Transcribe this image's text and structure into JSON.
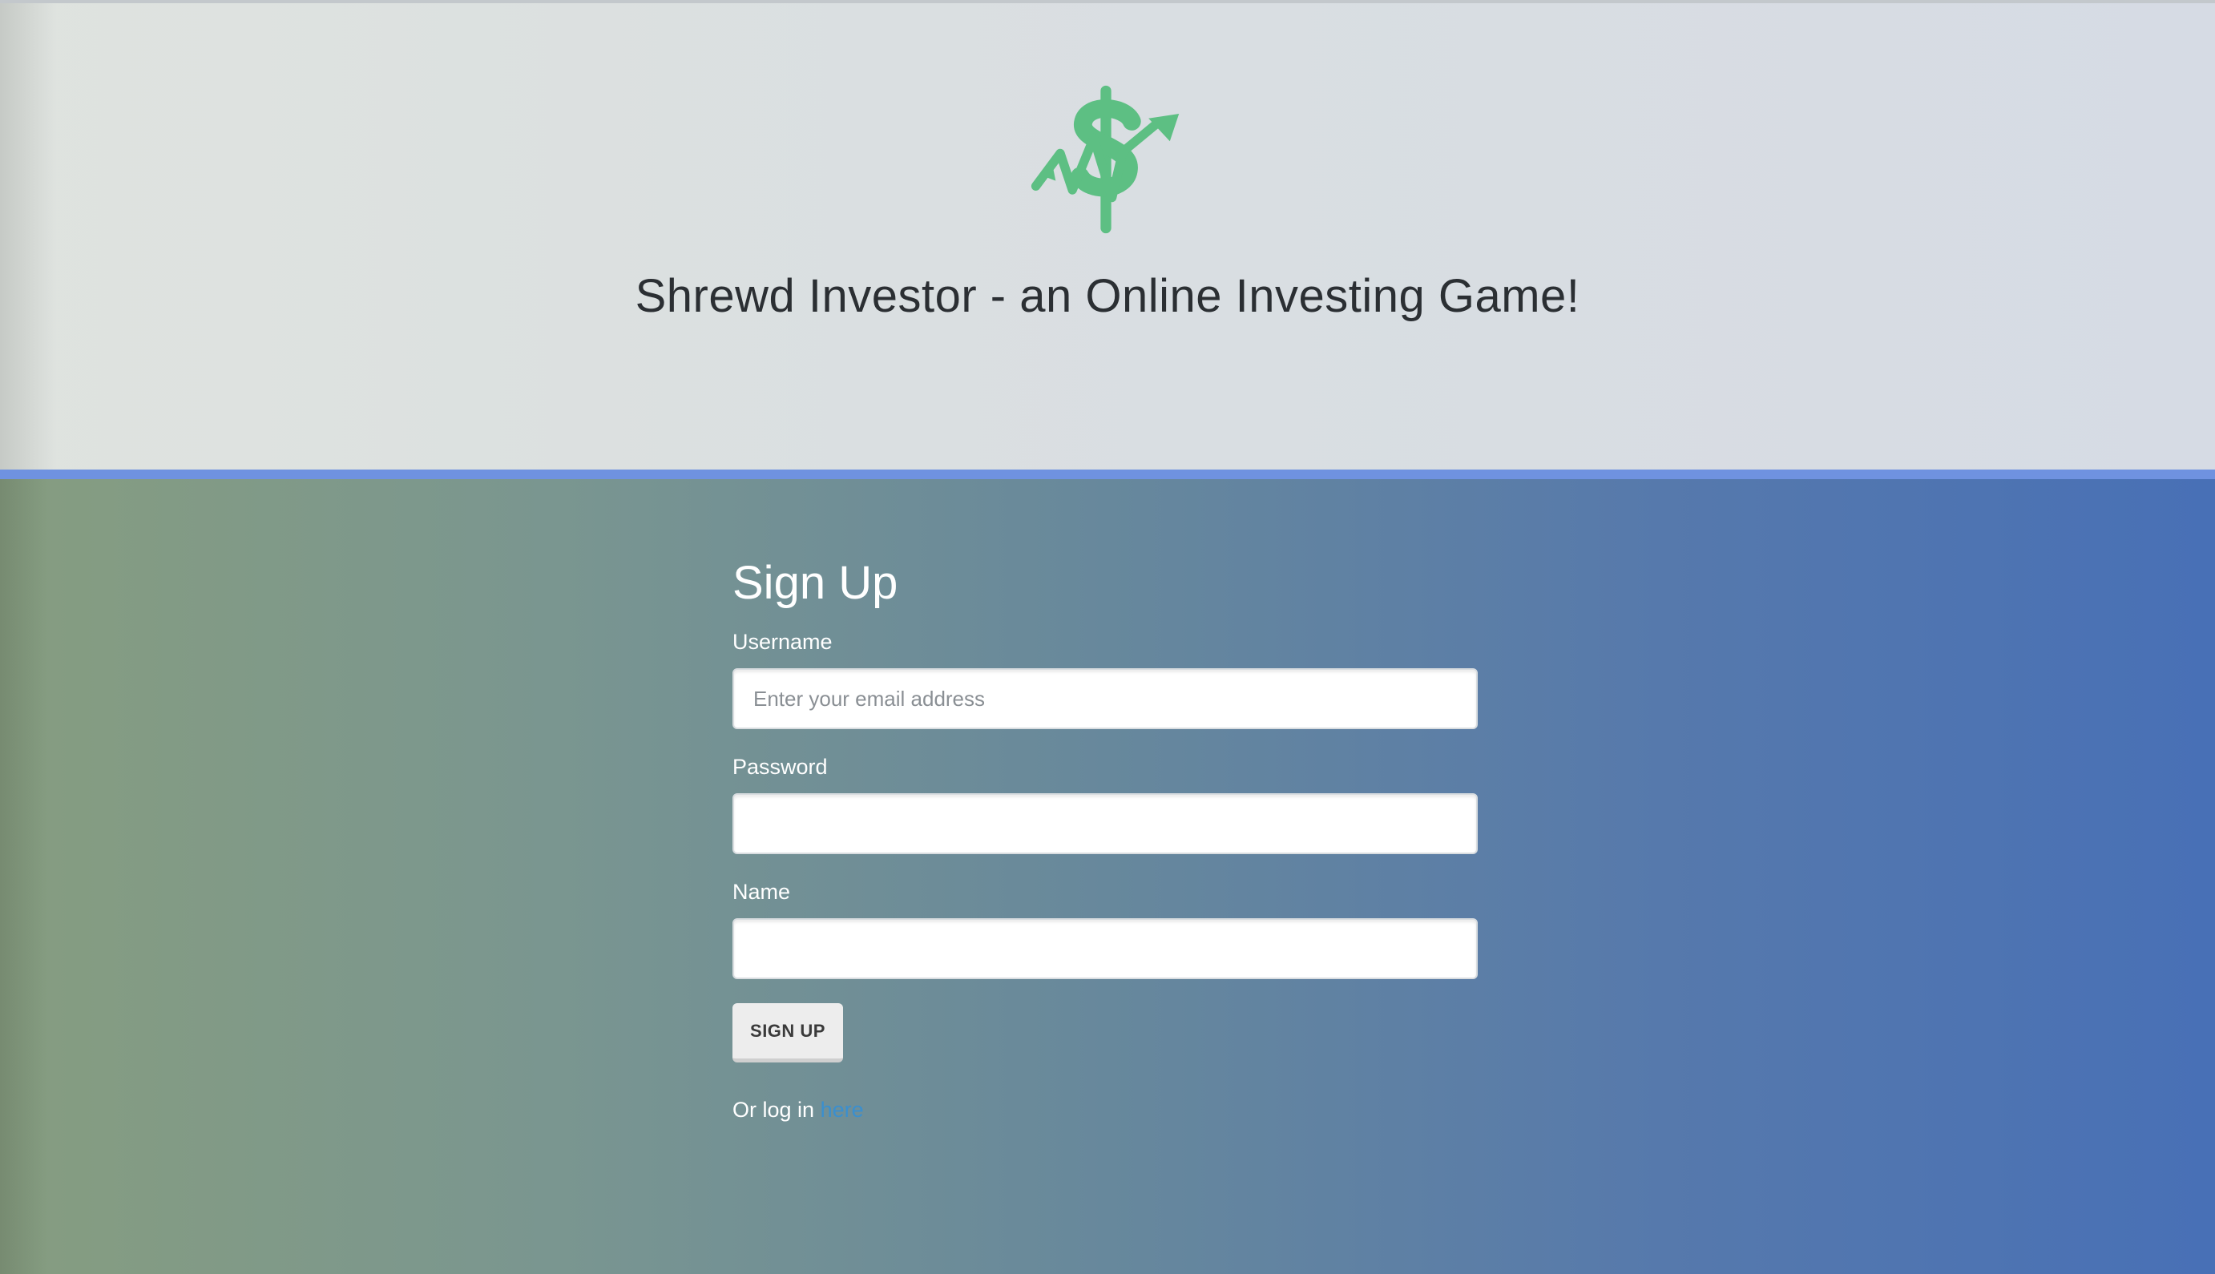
{
  "header": {
    "title": "Shrewd Investor - an Online Investing Game!",
    "logo_icon": "dollar-chart-logo-icon",
    "logo_color": "#5dbf83"
  },
  "colors": {
    "divider": "#6f92e0",
    "link": "#3a8fcf",
    "gradient_left": "#869d80",
    "gradient_right": "#4870b6"
  },
  "signup": {
    "heading": "Sign Up",
    "username_label": "Username",
    "username_placeholder": "Enter your email address",
    "username_value": "",
    "password_label": "Password",
    "password_value": "",
    "name_label": "Name",
    "name_value": "",
    "submit_label": "SIGN UP",
    "login_prefix": "Or log in",
    "login_link": "here"
  }
}
